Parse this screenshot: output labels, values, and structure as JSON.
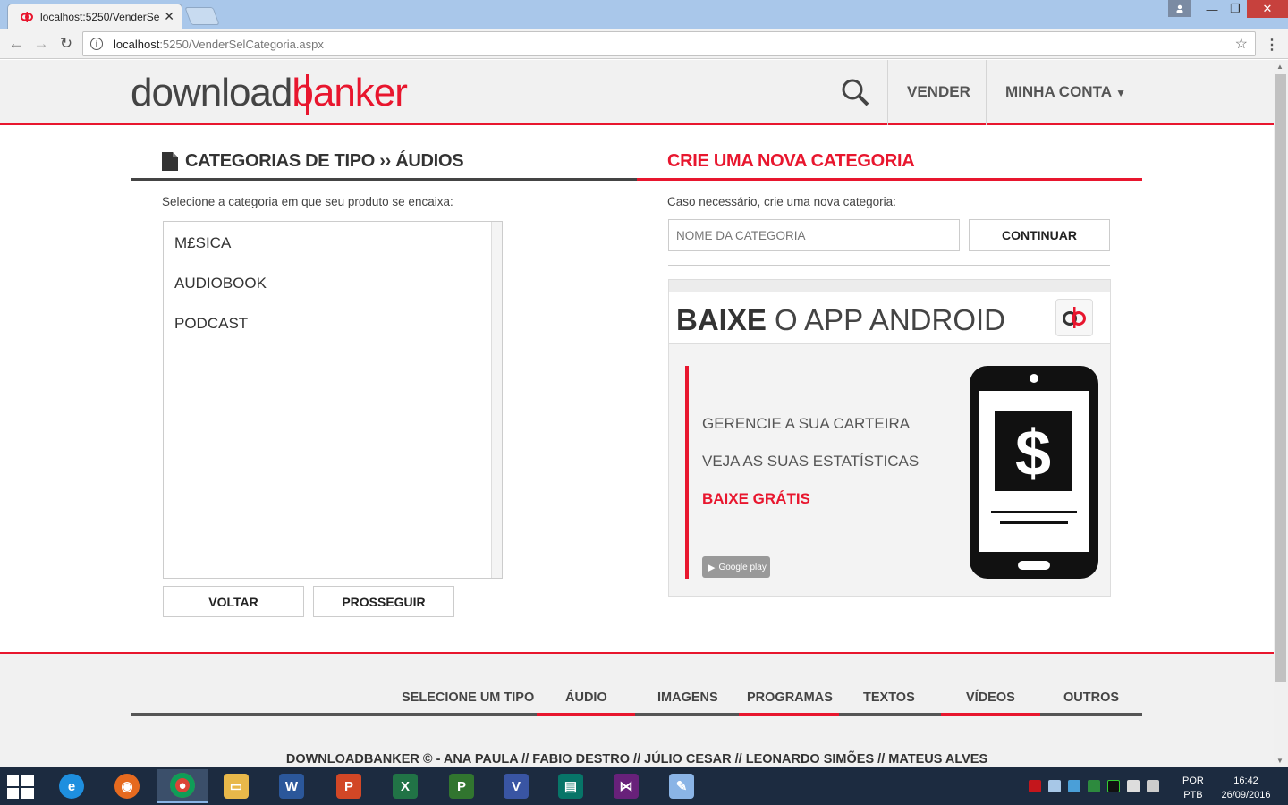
{
  "browser": {
    "tab_title": "localhost:5250/VenderSe",
    "url_host": "localhost",
    "url_path": ":5250/VenderSelCategoria.aspx"
  },
  "header": {
    "logo_dark": "download",
    "logo_red": "banker",
    "nav_sell": "VENDER",
    "nav_account": "MINHA CONTA"
  },
  "left": {
    "title": "CATEGORIAS DE TIPO ›› ÁUDIOS",
    "hint": "Selecione a categoria em que seu produto se encaixa:",
    "items": [
      "M£SICA",
      "AUDIOBOOK",
      "PODCAST"
    ],
    "back_label": "VOLTAR",
    "next_label": "PROSSEGUIR"
  },
  "right": {
    "title": "CRIE UMA NOVA CATEGORIA",
    "hint": "Caso necessário, crie uma nova categoria:",
    "input_placeholder": "NOME DA CATEGORIA",
    "continue_label": "CONTINUAR"
  },
  "promo": {
    "head_bold": "BAIXE",
    "head_rest": " O APP ANDROID",
    "line1": "GERENCIE A SUA CARTEIRA",
    "line2": "VEJA AS SUAS ESTATÍSTICAS",
    "line3": "BAIXE GRÁTIS",
    "store_badge": "Google play"
  },
  "footer": {
    "nav": [
      "SELECIONE UM TIPO",
      "ÁUDIO",
      "IMAGENS",
      "PROGRAMAS",
      "TEXTOS",
      "VÍDEOS",
      "OUTROS"
    ],
    "credits": "DOWNLOADBANKER © - ANA PAULA // FABIO DESTRO // JÚLIO CESAR // LEONARDO SIMÕES // MATEUS ALVES"
  },
  "taskbar": {
    "lang_top": "POR",
    "lang_bottom": "PTB",
    "time": "16:42",
    "date": "26/09/2016"
  },
  "colors": {
    "accent": "#e8162e",
    "text": "#444444",
    "header_bg": "#f1f1f1"
  }
}
